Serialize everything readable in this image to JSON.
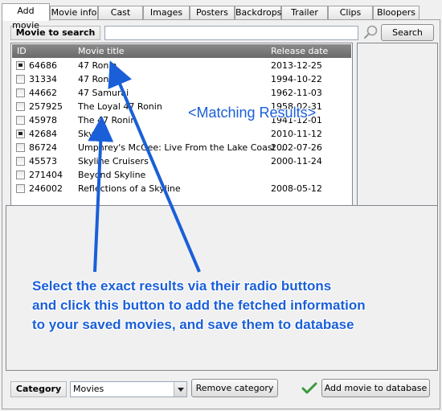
{
  "tabs": [
    "Add movie",
    "Movie info",
    "Cast",
    "Images",
    "Posters",
    "Backdrops",
    "Trailer",
    "Clips",
    "Bloopers"
  ],
  "search": {
    "label": "Movie to search",
    "value": "",
    "button": "Search"
  },
  "columns": {
    "id": "ID",
    "title": "Movie title",
    "date": "Release date"
  },
  "rows": [
    {
      "id": "64686",
      "title": "47 Ronin",
      "date": "2013-12-25",
      "checked": true
    },
    {
      "id": "31334",
      "title": "47 Ronin",
      "date": "1994-10-22",
      "checked": false
    },
    {
      "id": "44662",
      "title": "47 Samurai",
      "date": "1962-11-03",
      "checked": false
    },
    {
      "id": "257925",
      "title": "The Loyal 47 Ronin",
      "date": "1958-02-31",
      "checked": false
    },
    {
      "id": "45978",
      "title": "The 47 Ronin",
      "date": "1941-12-01",
      "checked": false
    },
    {
      "id": "42684",
      "title": "Skyline",
      "date": "2010-11-12",
      "checked": true
    },
    {
      "id": "86724",
      "title": "Umphrey's McGee: Live From the Lake Coast ...",
      "date": "2002-07-26",
      "checked": false
    },
    {
      "id": "45573",
      "title": "Skyline Cruisers",
      "date": "2000-11-24",
      "checked": false
    },
    {
      "id": "271404",
      "title": "Beyond Skyline",
      "date": "",
      "checked": false
    },
    {
      "id": "246002",
      "title": "Reflections of a Skyline",
      "date": "2008-05-12",
      "checked": false
    }
  ],
  "annotations": {
    "title": "<Matching Results>",
    "line1": "Select the exact results via their radio buttons",
    "line2": "and click this button to add the fetched information",
    "line3": "to your saved movies, and save them to database"
  },
  "footer": {
    "category_label": "Category",
    "category_value": "Movies",
    "remove_button": "Remove category",
    "add_button": "Add movie to database"
  },
  "colors": {
    "annotation": "#1a5fd8",
    "check": "#3a9a3a"
  }
}
